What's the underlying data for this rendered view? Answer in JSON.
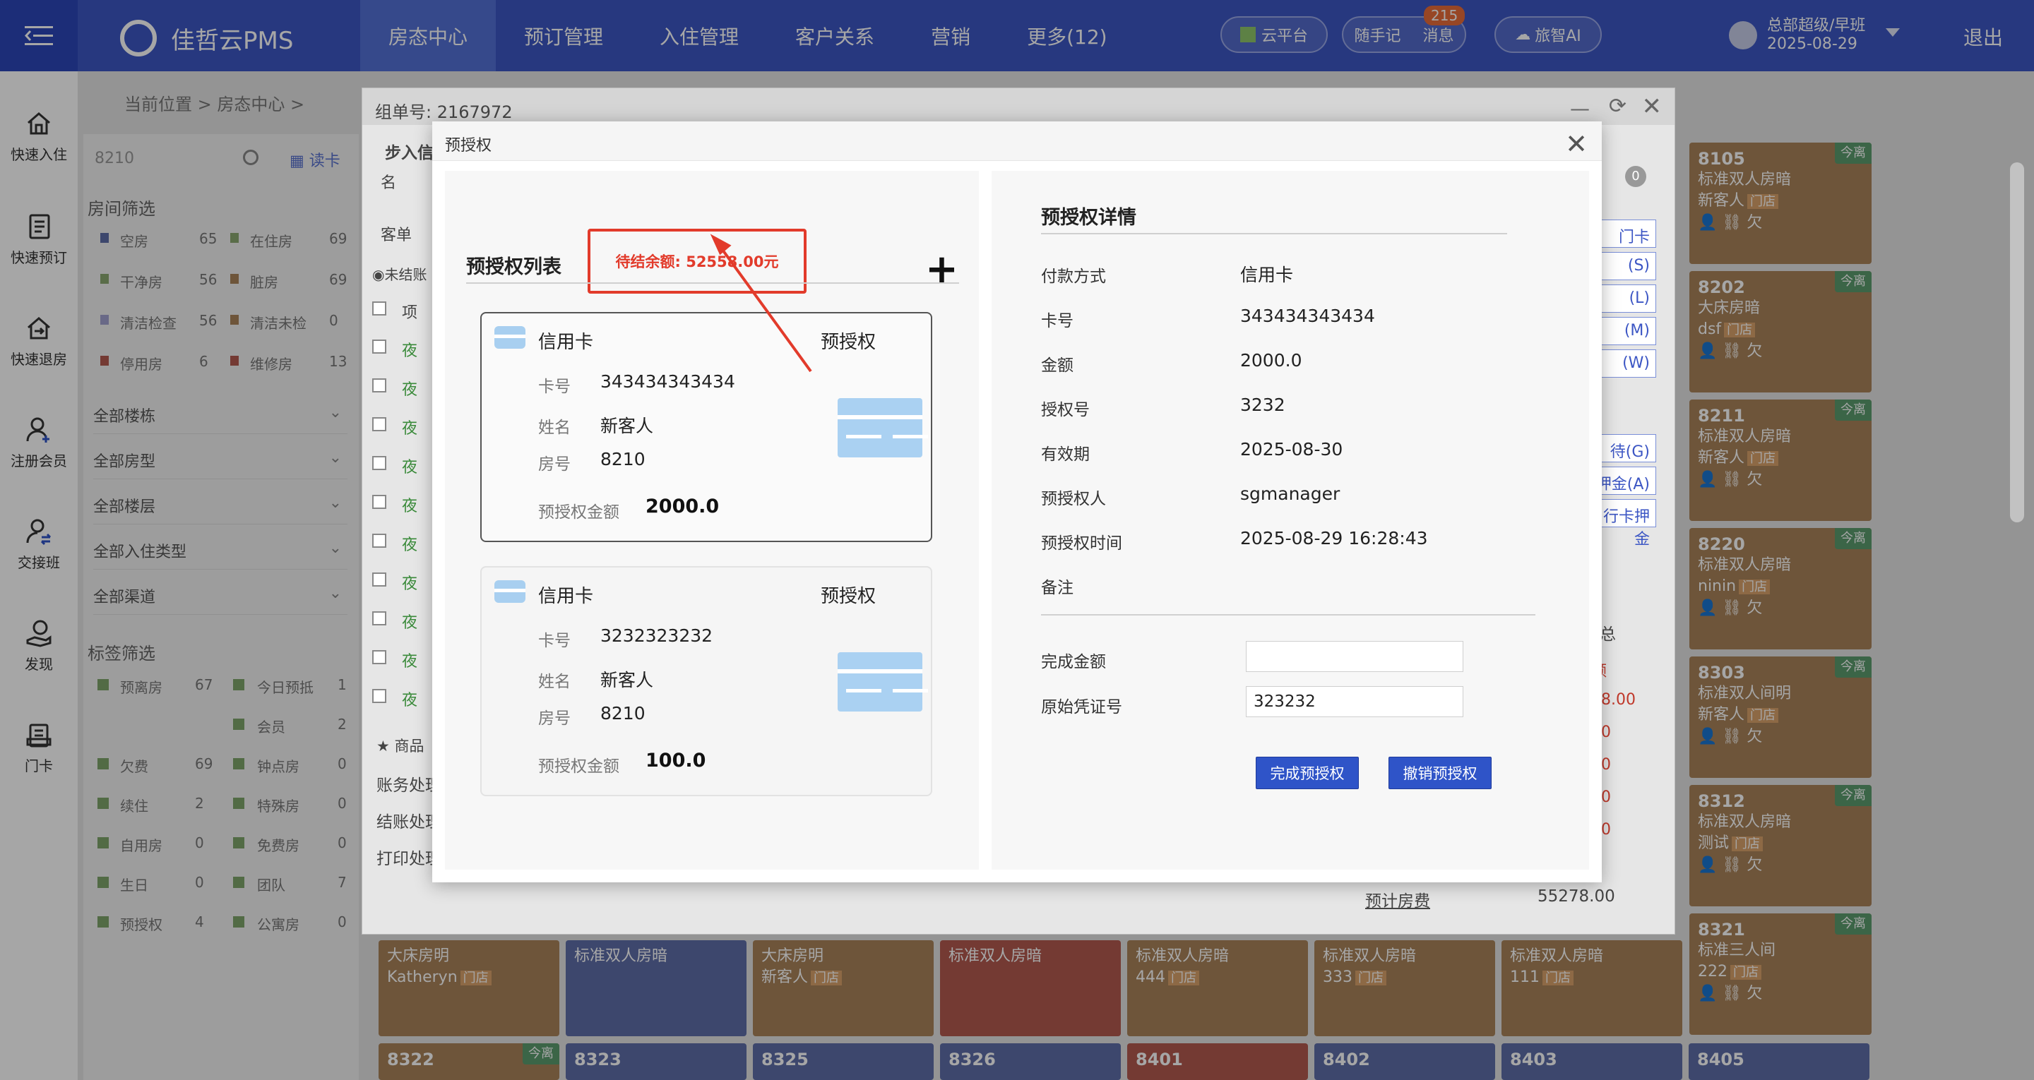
{
  "app": {
    "name": "佳哲云PMS",
    "nav": [
      "房态中心",
      "预订管理",
      "入住管理",
      "客户关系",
      "营销",
      "更多(12)"
    ],
    "active_nav": "房态中心",
    "cloud_platform": "云平台",
    "notes": "随手记",
    "messages": "消息",
    "message_count": "215",
    "ai": "旅智AI",
    "user_name": "总部超级/早班",
    "user_date": "2025-08-29",
    "logout": "退出"
  },
  "sidebar": {
    "items": [
      {
        "label": "快速入住",
        "icon": "home-icon"
      },
      {
        "label": "快速预订",
        "icon": "notebook-icon"
      },
      {
        "label": "快速退房",
        "icon": "checkout-icon"
      },
      {
        "label": "注册会员",
        "icon": "add-user-icon"
      },
      {
        "label": "交接班",
        "icon": "handover-icon"
      },
      {
        "label": "发现",
        "icon": "discover-icon"
      },
      {
        "label": "门卡",
        "icon": "card-icon"
      }
    ]
  },
  "background": {
    "breadcrumb": "当前位置 > 房态中心 >",
    "search_value": "8210",
    "read_card": "读卡",
    "room_filter_title": "房间筛选",
    "room_filters": [
      [
        "空房",
        "65",
        "在住房",
        "69"
      ],
      [
        "干净房",
        "56",
        "脏房",
        "69"
      ],
      [
        "清洁检查",
        "56",
        "清洁未检",
        "0"
      ],
      [
        "停用房",
        "6",
        "维修房",
        "13"
      ]
    ],
    "dropdowns": [
      "全部楼栋",
      "全部房型",
      "全部楼层",
      "全部入住类型",
      "全部渠道"
    ],
    "tag_filter_title": "标签筛选",
    "tag_filters": [
      [
        "预离房",
        "67",
        "今日预抵",
        "1"
      ],
      [
        "",
        "",
        "会员",
        "2"
      ],
      [
        "欠费",
        "69",
        "钟点房",
        "0"
      ],
      [
        "续住",
        "2",
        "特殊房",
        "0"
      ],
      [
        "自用房",
        "0",
        "免费房",
        "0"
      ],
      [
        "生日",
        "0",
        "团队",
        "7"
      ],
      [
        "预授权",
        "4",
        "公寓房",
        "0"
      ]
    ],
    "right_rooms": [
      {
        "num": "8105",
        "type": "标准双人房暗",
        "guest": "新客人",
        "badge": "今离"
      },
      {
        "num": "8202",
        "type": "大床房暗",
        "guest": "dsf",
        "badge": "今离"
      },
      {
        "num": "8211",
        "type": "标准双人房暗",
        "guest": "新客人",
        "badge": "今离"
      },
      {
        "num": "8220",
        "type": "标准双人房暗",
        "guest": "ninin",
        "badge": "今离"
      },
      {
        "num": "8303",
        "type": "标准双人间明",
        "guest": "新客人",
        "badge": "今离"
      },
      {
        "num": "8312",
        "type": "标准双人房暗",
        "guest": "测试",
        "badge": "今离"
      },
      {
        "num": "8321",
        "type": "标准三人间",
        "guest": "222",
        "badge": "今离"
      }
    ],
    "bottom_rooms": [
      {
        "type": "大床房明",
        "guest": "Katheryn",
        "color": "brown"
      },
      {
        "type": "标准双人房暗",
        "guest": "",
        "color": "blue"
      },
      {
        "type": "大床房明",
        "guest": "新客人",
        "color": "brown"
      },
      {
        "type": "标准双人房暗",
        "guest": "",
        "color": "red"
      },
      {
        "type": "标准双人房暗",
        "guest": "444",
        "color": "brown"
      },
      {
        "type": "标准双人房暗",
        "guest": "333",
        "color": "brown"
      },
      {
        "type": "标准双人房暗",
        "guest": "111",
        "color": "brown"
      }
    ],
    "last_row_rooms": [
      "8322",
      "8323",
      "8325",
      "8326",
      "8401",
      "8402",
      "8403",
      "8405"
    ],
    "door_label": "门店",
    "today_label": "今离"
  },
  "parent_dialog": {
    "title": "组单号: 2167972",
    "step_label": "步入信",
    "col_name": "名",
    "tab_guest": "客单",
    "unsettled": "未结账",
    "col_item": "项",
    "row_prefix": "夜",
    "goods": "商品",
    "account_ops": "账务处理",
    "checkout_ops": "结账处理",
    "print_ops": "打印处理",
    "side_buttons": [
      "门卡",
      "(S)",
      "(L)",
      "(M)",
      "(W)",
      "待(G)",
      "押金(A)",
      "行卡押金"
    ],
    "summary_title": "权汇总",
    "summary_vals": [
      "额",
      "58.00",
      "00",
      "00",
      "00",
      "00"
    ],
    "estimate_label": "预计房费",
    "estimate_value": "55278.00",
    "badge_zero": "0"
  },
  "dialog": {
    "title": "预授权",
    "list_title": "预授权列表",
    "balance_label": "待结余额: 52558.00元",
    "cards": [
      {
        "type": "信用卡",
        "tag": "预授权",
        "card_label": "卡号",
        "card_no": "343434343434",
        "name_label": "姓名",
        "name": "新客人",
        "room_label": "房号",
        "room": "8210",
        "amount_label": "预授权金额",
        "amount": "2000.0",
        "selected": true
      },
      {
        "type": "信用卡",
        "tag": "预授权",
        "card_label": "卡号",
        "card_no": "3232323232",
        "name_label": "姓名",
        "name": "新客人",
        "room_label": "房号",
        "room": "8210",
        "amount_label": "预授权金额",
        "amount": "100.0",
        "selected": false
      }
    ],
    "detail_title": "预授权详情",
    "details": [
      {
        "label": "付款方式",
        "value": "信用卡"
      },
      {
        "label": "卡号",
        "value": "343434343434"
      },
      {
        "label": "金额",
        "value": "2000.0"
      },
      {
        "label": "授权号",
        "value": "3232"
      },
      {
        "label": "有效期",
        "value": "2025-08-30"
      },
      {
        "label": "预授权人",
        "value": "sgmanager"
      },
      {
        "label": "预授权时间",
        "value": "2025-08-29 16:28:43"
      },
      {
        "label": "备注",
        "value": ""
      }
    ],
    "complete_amount_label": "完成金额",
    "complete_amount_value": "",
    "voucher_label": "原始凭证号",
    "voucher_value": "323232",
    "complete_button": "完成预授权",
    "cancel_button": "撤销预授权",
    "annotation_color": "#e23b2b",
    "primary_color": "#2f54c8"
  }
}
